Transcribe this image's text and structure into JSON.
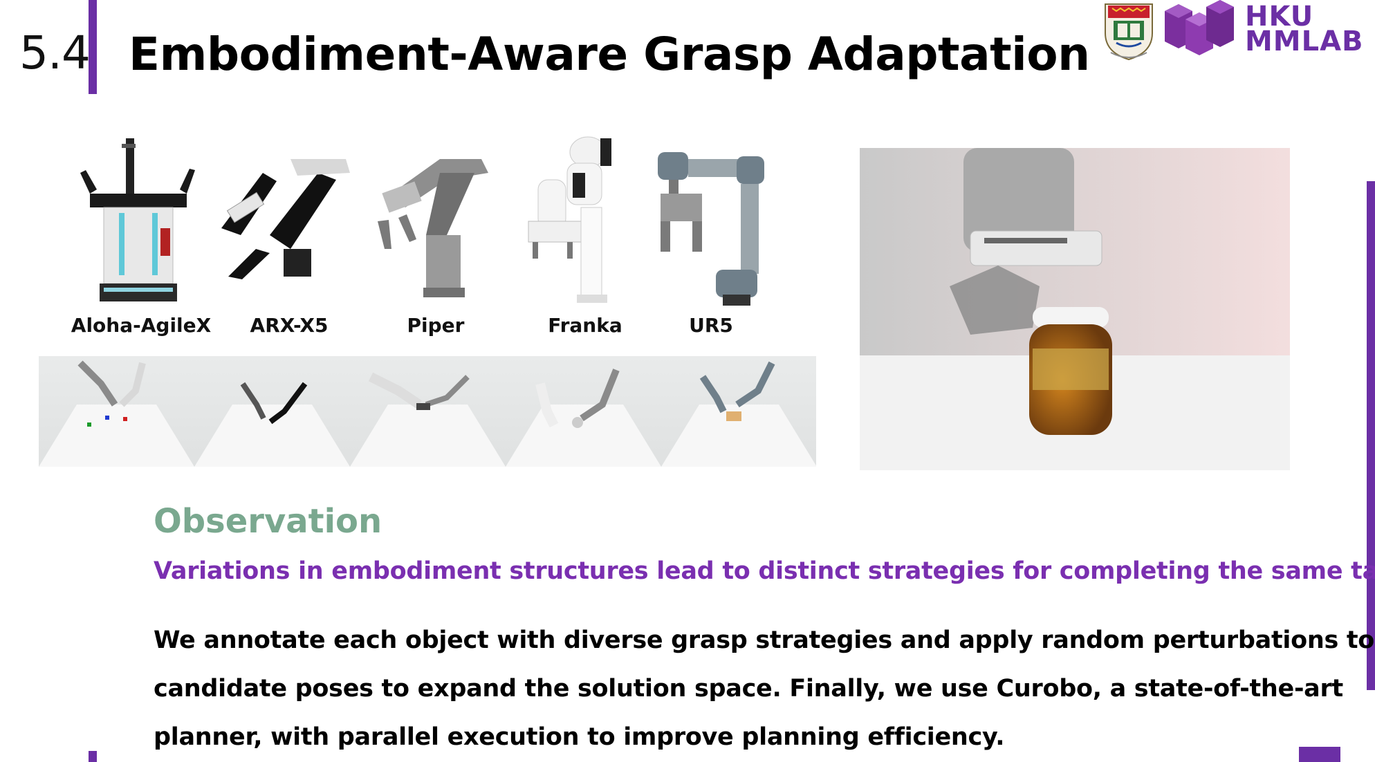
{
  "header": {
    "section_number": "5.4",
    "title": "Embodiment-Aware Grasp Adaptation"
  },
  "logo": {
    "line1": "HKU",
    "line2": "MMLAB"
  },
  "robots": [
    {
      "label": "Aloha-AgileX"
    },
    {
      "label": "ARX-X5"
    },
    {
      "label": "Piper"
    },
    {
      "label": "Franka"
    },
    {
      "label": "UR5"
    }
  ],
  "observation": {
    "heading": "Observation",
    "statement": "Variations in embodiment structures lead to distinct strategies for completing the same task.",
    "body_lines": [
      "We annotate each object with diverse grasp strategies and apply random perturbations to",
      "candidate poses to expand the solution space. Finally, we use Curobo, a state-of-the-art",
      "planner, with parallel execution to improve planning efficiency."
    ]
  },
  "colors": {
    "accent": "#6b2fa5",
    "observation_heading": "#7aa88f",
    "statement": "#7a2fb0"
  }
}
